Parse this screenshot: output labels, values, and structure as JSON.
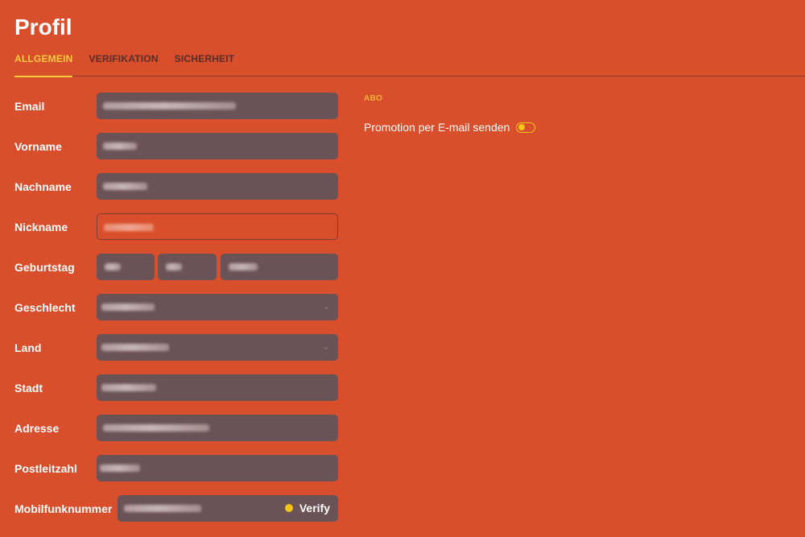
{
  "page": {
    "title": "Profil"
  },
  "tabs": [
    {
      "label": "ALLGEMEIN",
      "active": true
    },
    {
      "label": "VERIFIKATION",
      "active": false
    },
    {
      "label": "SICHERHEIT",
      "active": false
    }
  ],
  "form": {
    "email_label": "Email",
    "firstname_label": "Vorname",
    "lastname_label": "Nachname",
    "nickname_label": "Nickname",
    "birthday_label": "Geburtstag",
    "gender_label": "Geschlecht",
    "country_label": "Land",
    "city_label": "Stadt",
    "address_label": "Adresse",
    "zip_label": "Postleitzahl",
    "mobile_label": "Mobilfunknummer",
    "verify_label": "Verify"
  },
  "subscription": {
    "title": "ABO",
    "promo_label": "Promotion per E-mail senden",
    "promo_enabled": false
  },
  "colors": {
    "background": "#d94e2b",
    "accent": "#f7cc3c",
    "field_bg": "#6b5256"
  },
  "icons": {
    "dropdown": "chevron-down-icon",
    "status": "dot-icon"
  }
}
